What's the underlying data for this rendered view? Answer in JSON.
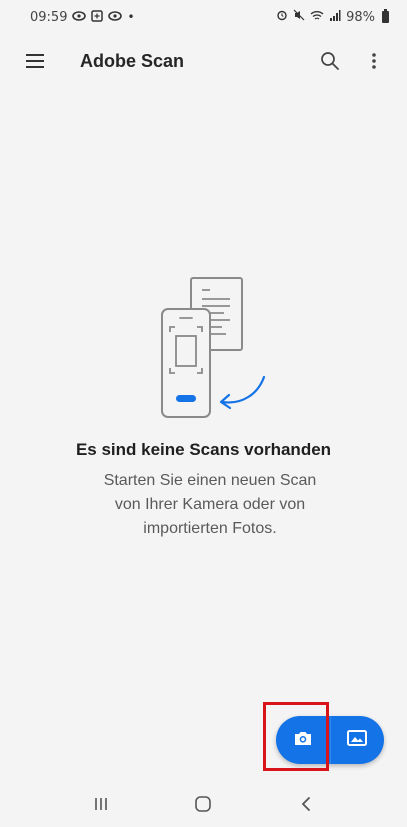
{
  "status_bar": {
    "time": "09:59",
    "left_icons": [
      "eye-icon",
      "screenshot-icon",
      "eye-icon",
      "dot-icon"
    ],
    "right_icons": [
      "alarm-icon",
      "mute-icon",
      "wifi-icon",
      "signal-icon"
    ],
    "battery": "98%"
  },
  "app_bar": {
    "title": "Adobe Scan",
    "menu_icon": "hamburger-icon",
    "search_icon": "search-icon",
    "more_icon": "more-vert-icon"
  },
  "empty_state": {
    "illustration": "phone-document-scan-illustration",
    "title": "Es sind keine Scans vorhanden",
    "line1": "Starten Sie einen neuen Scan",
    "line2": "von Ihrer Kamera oder von",
    "line3": "importierten Fotos."
  },
  "fab": {
    "camera_icon": "camera-icon",
    "gallery_icon": "image-icon",
    "color": "#1473e6"
  },
  "highlight": {
    "color": "#d8141a"
  },
  "nav_bar": {
    "recent_icon": "recent-apps-icon",
    "home_icon": "home-icon",
    "back_icon": "back-icon"
  },
  "colors": {
    "background": "#f4f4f4",
    "accent": "#1473e6",
    "illustration_stroke": "#8a8a8a"
  }
}
